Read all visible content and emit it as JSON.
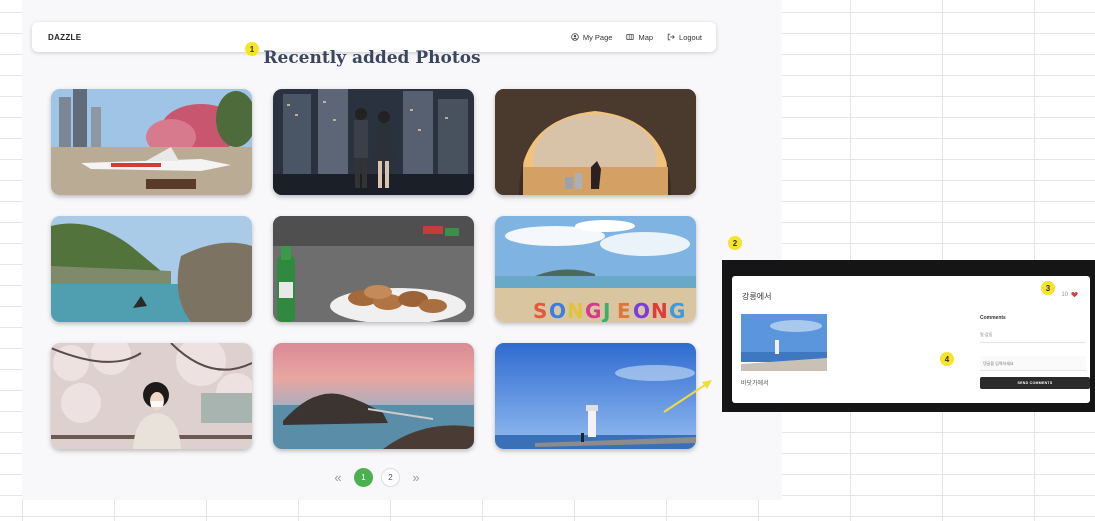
{
  "navbar": {
    "brand": "DAZZLE",
    "links": [
      {
        "label": "My Page",
        "icon": "user-circle-icon"
      },
      {
        "label": "Map",
        "icon": "map-icon"
      },
      {
        "label": "Logout",
        "icon": "logout-icon"
      }
    ]
  },
  "page_title": "Recently added Photos",
  "photos": [
    {
      "icon": "airplane-park-photo"
    },
    {
      "icon": "city-night-couple-photo"
    },
    {
      "icon": "cave-sunset-photo"
    },
    {
      "icon": "coastal-cliff-photo"
    },
    {
      "icon": "seafood-soju-photo"
    },
    {
      "icon": "songjeong-beach-photo"
    },
    {
      "icon": "cherry-blossom-portrait-photo"
    },
    {
      "icon": "island-sunset-photo"
    },
    {
      "icon": "lighthouse-pier-photo"
    }
  ],
  "pagination": {
    "prev": "«",
    "next": "»",
    "pages": [
      "1",
      "2"
    ],
    "current": "1"
  },
  "annotations": [
    "1",
    "2",
    "3",
    "4"
  ],
  "modal": {
    "title": "강릉에서",
    "like_count": "10",
    "caption": "바닷가에서",
    "comments_title": "Comments",
    "comments": [
      "멋·감동"
    ],
    "comment_placeholder": "댓글을 입력하세요",
    "send_label": "SEND COMMENTS"
  },
  "colors": {
    "accent": "#4caf50",
    "title": "#3a4660",
    "badge": "#f5e427",
    "heart": "#e53935"
  }
}
